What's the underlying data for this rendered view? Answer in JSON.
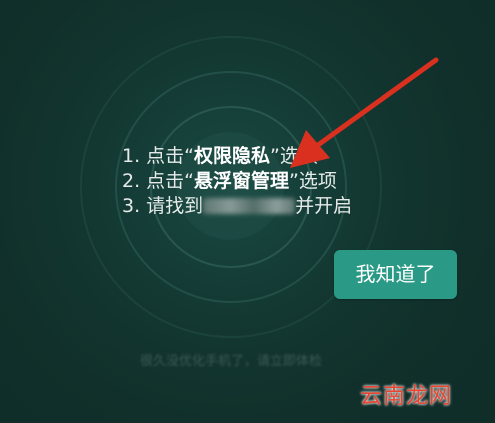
{
  "dialog": {
    "steps": [
      {
        "prefix": "1. 点击“",
        "highlight": "权限隐私",
        "suffix": "”选项"
      },
      {
        "prefix": "2. 点击“",
        "highlight": "悬浮窗管理",
        "suffix": "”选项"
      },
      {
        "prefix": "3. 请找到",
        "redacted": true,
        "suffix": "并开启"
      }
    ],
    "ok_button_label": "我知道了"
  },
  "background_hint": "很久没优化手机了，请立即体检",
  "watermark": "云南龙网",
  "colors": {
    "background": "#11302b",
    "button": "#2a9a86",
    "arrow": "#d9301f",
    "watermark": "#e8442f"
  }
}
